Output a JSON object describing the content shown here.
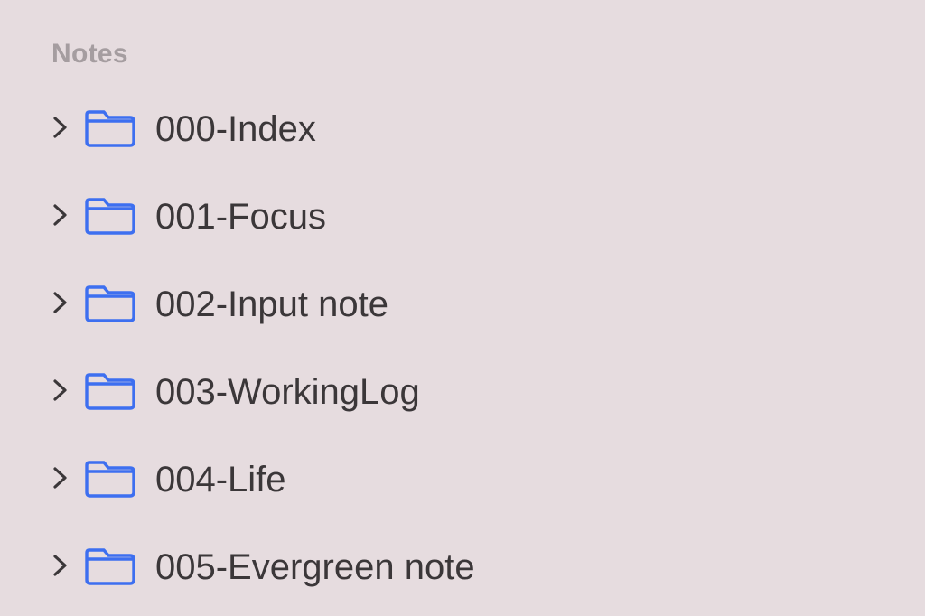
{
  "sidebar": {
    "section_title": "Notes",
    "accent_color": "#3d6ff0",
    "folders": [
      {
        "label": "000-Index",
        "icon": "folder-icon",
        "expanded": false
      },
      {
        "label": "001-Focus",
        "icon": "folder-icon",
        "expanded": false
      },
      {
        "label": "002-Input note",
        "icon": "folder-icon",
        "expanded": false
      },
      {
        "label": "003-WorkingLog",
        "icon": "folder-icon",
        "expanded": false
      },
      {
        "label": "004-Life",
        "icon": "folder-icon",
        "expanded": false
      },
      {
        "label": "005-Evergreen note",
        "icon": "folder-icon",
        "expanded": false
      }
    ]
  }
}
